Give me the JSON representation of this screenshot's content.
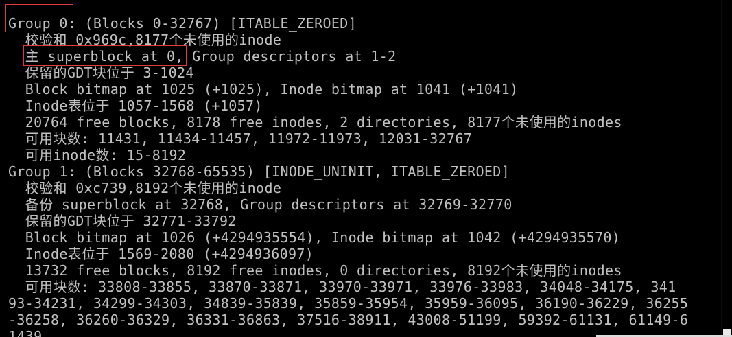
{
  "terminal": {
    "lines": [
      "Group 0: (Blocks 0-32767) [ITABLE_ZEROED]",
      "  校验和 0x969c,8177个未使用的inode",
      "  主 superblock at 0, Group descriptors at 1-2",
      "  保留的GDT块位于 3-1024",
      "  Block bitmap at 1025 (+1025), Inode bitmap at 1041 (+1041)",
      "  Inode表位于 1057-1568 (+1057)",
      "  20764 free blocks, 8178 free inodes, 2 directories, 8177个未使用的inodes",
      "  可用块数: 11431, 11434-11457, 11972-11973, 12031-32767",
      "  可用inode数: 15-8192",
      "Group 1: (Blocks 32768-65535) [INODE_UNINIT, ITABLE_ZEROED]",
      "  校验和 0xc739,8192个未使用的inode",
      "  备份 superblock at 32768, Group descriptors at 32769-32770",
      "  保留的GDT块位于 32771-33792",
      "  Block bitmap at 1026 (+4294935554), Inode bitmap at 1042 (+4294935570)",
      "  Inode表位于 1569-2080 (+4294936097)",
      "  13732 free blocks, 8192 free inodes, 0 directories, 8192个未使用的inodes",
      "  可用块数: 33808-33855, 33870-33871, 33970-33971, 33976-33983, 34048-34175, 341",
      "93-34231, 34299-34303, 34839-35839, 35859-35954, 35959-36095, 36190-36229, 36255",
      "-36258, 36260-36329, 36331-36863, 37516-38911, 43008-51199, 59392-61131, 61149-6",
      "1439"
    ]
  },
  "colors": {
    "background": "#000000",
    "text": "#c0c0c0",
    "annotation": "#e03a3a"
  }
}
